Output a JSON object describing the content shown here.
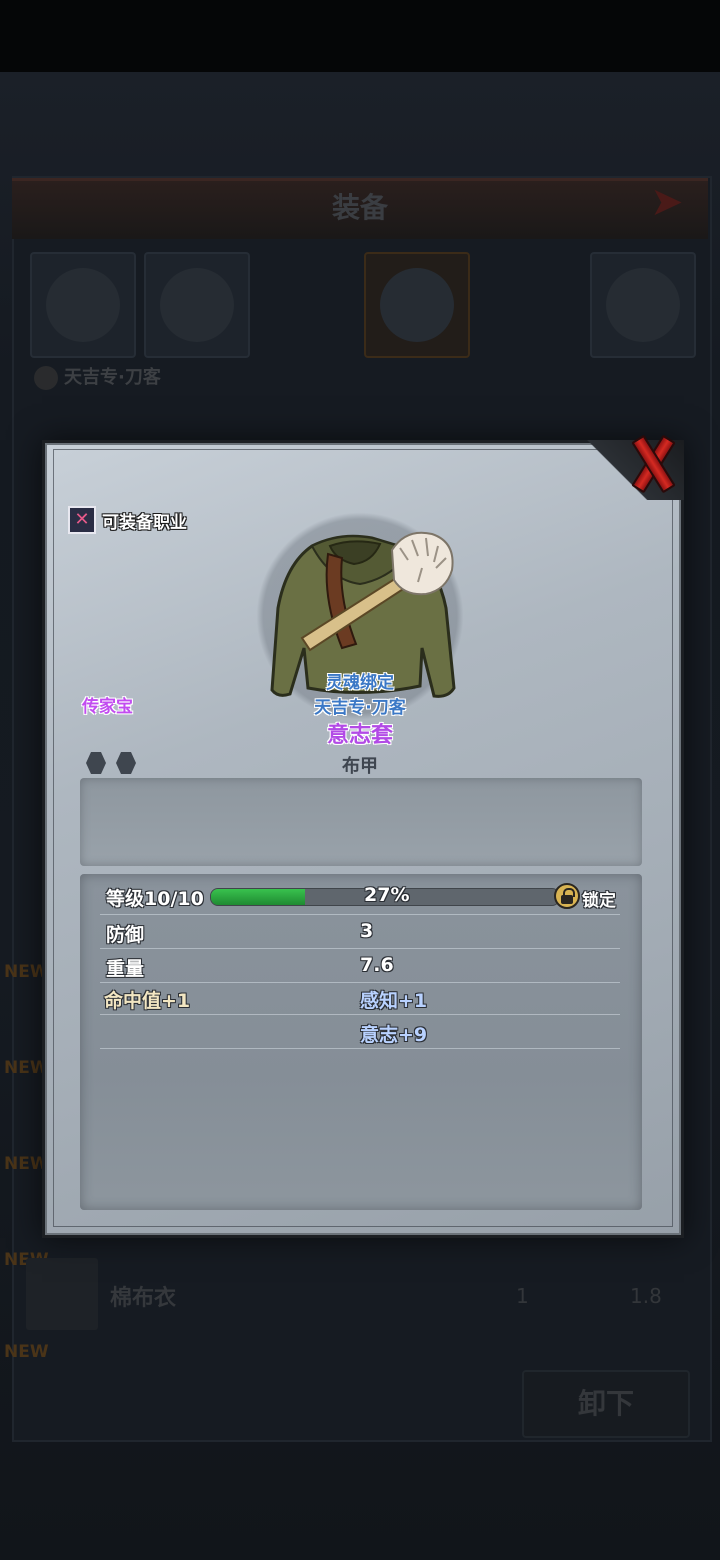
{
  "background": {
    "title": "装备",
    "character": "天吉专·刀客",
    "new_badge": "NEW",
    "list_item": {
      "name": "棉布衣",
      "value1": "1",
      "value2": "1.8"
    },
    "unequip_label": "卸下"
  },
  "item": {
    "job_label": "可装备职业",
    "rarity": "传家宝",
    "binding": "灵魂绑定",
    "owner": "天吉专·刀客",
    "name": "意志套",
    "type": "布甲",
    "level_label": "等级10/10",
    "level_progress_text": "27%",
    "level_progress": 27,
    "lock_label": "锁定",
    "stats": {
      "defense_label": "防御",
      "defense_value": "3",
      "weight_label": "重量",
      "weight_value": "7.6",
      "bonus_left_1": "命中值+1",
      "bonus_right_1": "感知+1",
      "bonus_right_2": "意志+9"
    }
  },
  "icons": {
    "close": "close-x-icon",
    "job": "crossed-swords-icon",
    "lock": "lock-icon",
    "socket": "hexagon-socket-icon"
  },
  "colors": {
    "rarity_purple": "#b24ae6",
    "binding_blue": "#3b78c6",
    "progress_green": "#2fb043",
    "close_red": "#d52a22"
  }
}
